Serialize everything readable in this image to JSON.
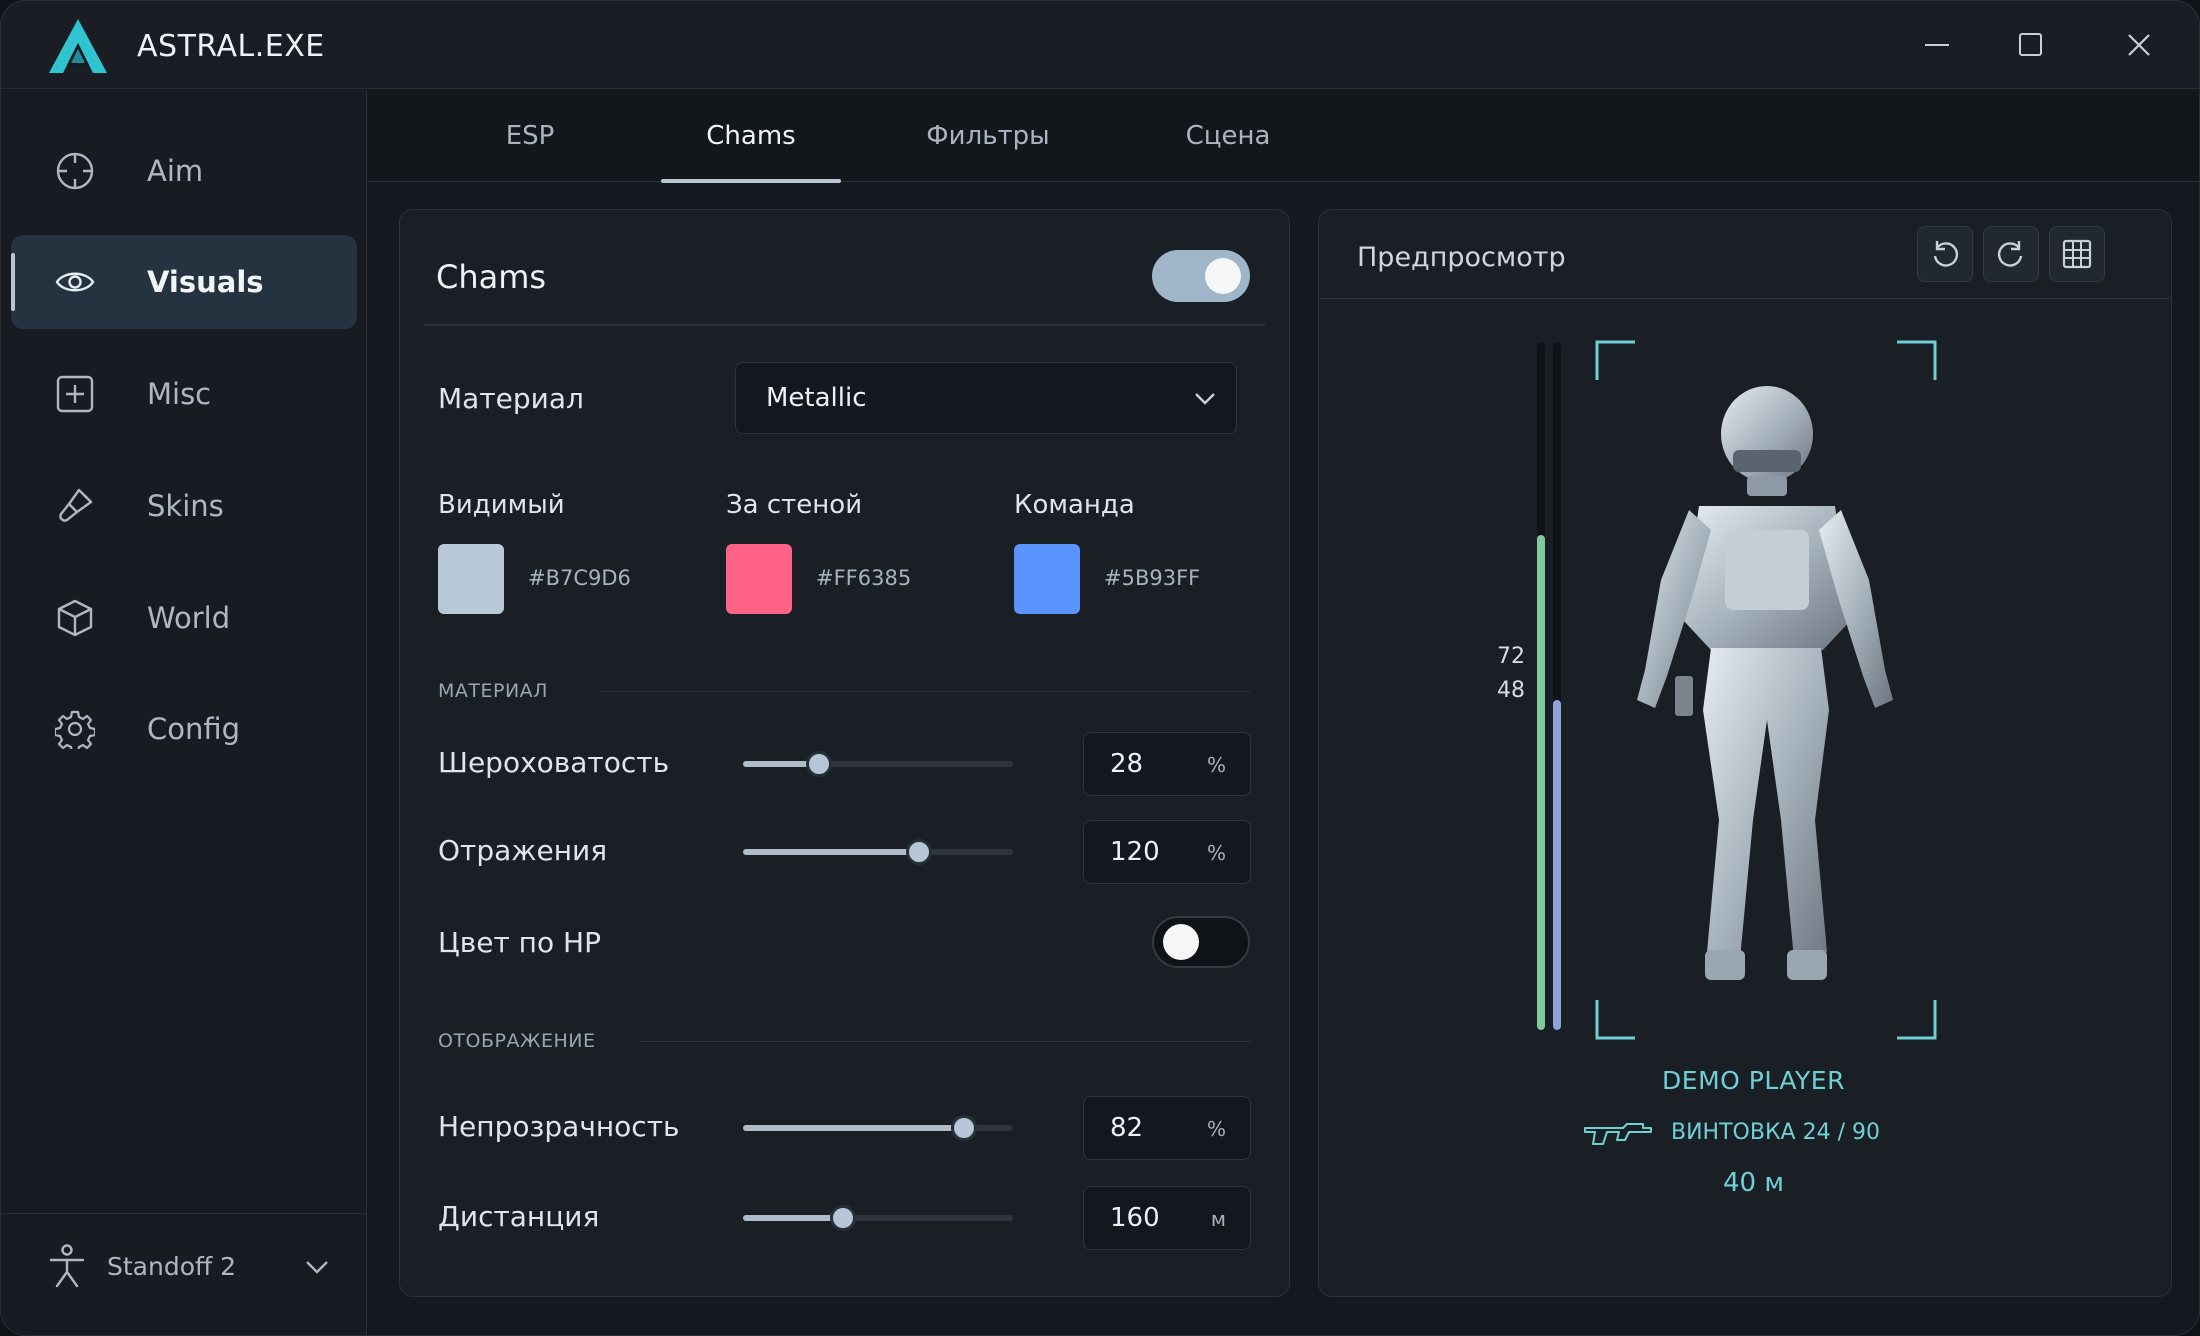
{
  "app": {
    "title": "ASTRAL.EXE"
  },
  "sidebar": {
    "items": [
      {
        "label": "Aim"
      },
      {
        "label": "Visuals"
      },
      {
        "label": "Misc"
      },
      {
        "label": "Skins"
      },
      {
        "label": "World"
      },
      {
        "label": "Config"
      }
    ],
    "active": "Visuals",
    "game": {
      "label": "Standoff 2"
    }
  },
  "tabs": [
    {
      "label": "ESP"
    },
    {
      "label": "Chams"
    },
    {
      "label": "Фильтры"
    },
    {
      "label": "Сцена"
    }
  ],
  "active_tab": "Chams",
  "chams": {
    "title": "Chams",
    "enabled": true,
    "material_label": "Материал",
    "material_value": "Metallic",
    "colors": [
      {
        "label": "Видимый",
        "hex": "#B7C9D6"
      },
      {
        "label": "За стеной",
        "hex": "#FF6385"
      },
      {
        "label": "Команда",
        "hex": "#5B93FF"
      }
    ],
    "section_material": "МАТЕРИАЛ",
    "roughness": {
      "label": "Шероховатость",
      "value": "28",
      "unit": "%",
      "fraction": 0.28
    },
    "reflections": {
      "label": "Отражения",
      "value": "120",
      "unit": "%",
      "fraction": 0.65
    },
    "hp_color": {
      "label": "Цвет по HP",
      "enabled": false
    },
    "section_display": "ОТОБРАЖЕНИЕ",
    "opacity": {
      "label": "Непрозрачность",
      "value": "82",
      "unit": "%",
      "fraction": 0.82
    },
    "distance": {
      "label": "Дистанция",
      "value": "160",
      "unit": "м",
      "fraction": 0.37
    }
  },
  "preview": {
    "title": "Предпросмотр",
    "health": {
      "value": "72",
      "fraction": 0.72,
      "color": "#7fc99a"
    },
    "armor": {
      "value": "48",
      "fraction": 0.48,
      "color": "#8ea4d8"
    },
    "player_name": "DEMO PLAYER",
    "weapon": "ВИНТОВКА 24 / 90",
    "distance": "40 м",
    "accent": "#6fd0d6"
  }
}
